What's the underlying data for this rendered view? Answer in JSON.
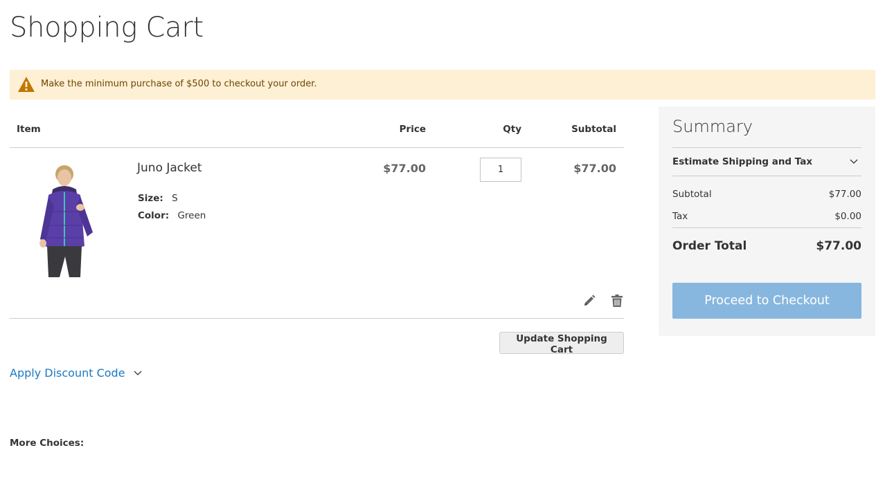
{
  "page": {
    "title": "Shopping Cart"
  },
  "notice": {
    "text": "Make the minimum purchase of $500 to checkout your order.",
    "icon": "warning-icon",
    "color": "#fdf0d5"
  },
  "cart": {
    "columns": {
      "item": "Item",
      "price": "Price",
      "qty": "Qty",
      "subtotal": "Subtotal"
    },
    "items": [
      {
        "name": "Juno Jacket",
        "options": [
          {
            "label": "Size:",
            "value": "S"
          },
          {
            "label": "Color:",
            "value": "Green"
          }
        ],
        "price": "$77.00",
        "qty": "1",
        "subtotal": "$77.00",
        "image_icon": "purple-jacket-photo",
        "actions": [
          "edit-icon",
          "delete-icon"
        ]
      }
    ],
    "update_label": "Update Shopping Cart"
  },
  "discount": {
    "label": "Apply Discount Code"
  },
  "more_choices": {
    "label": "More Choices:"
  },
  "summary": {
    "title": "Summary",
    "estimate_label": "Estimate Shipping and Tax",
    "subtotal_label": "Subtotal",
    "subtotal_value": "$77.00",
    "tax_label": "Tax",
    "tax_value": "$0.00",
    "total_label": "Order Total",
    "total_value": "$77.00",
    "checkout_label": "Proceed to Checkout",
    "checkout_color": "#87b7de"
  },
  "colors": {
    "link": "#1979c3",
    "summary_bg": "#f5f5f5"
  }
}
